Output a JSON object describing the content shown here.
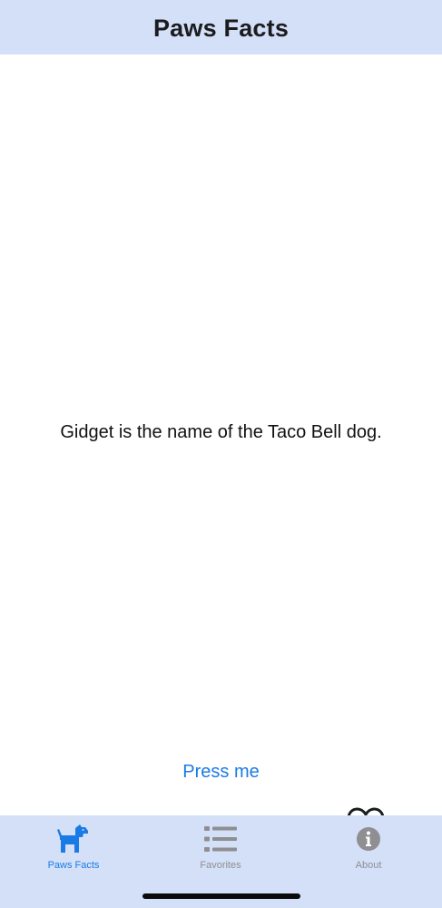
{
  "nav": {
    "title": "Paws Facts"
  },
  "main": {
    "fact": "Gidget is the name of the Taco Bell dog.",
    "press_button_label": "Press me",
    "favorite_icon": "heart-outline-icon"
  },
  "tabs": [
    {
      "label": "Paws Facts",
      "icon": "dog-icon",
      "active": true
    },
    {
      "label": "Favorites",
      "icon": "list-icon",
      "active": false
    },
    {
      "label": "About",
      "icon": "info-icon",
      "active": false
    }
  ],
  "colors": {
    "bar_background": "#d3e0f8",
    "accent": "#1a7be5",
    "inactive": "#8e8e93"
  }
}
